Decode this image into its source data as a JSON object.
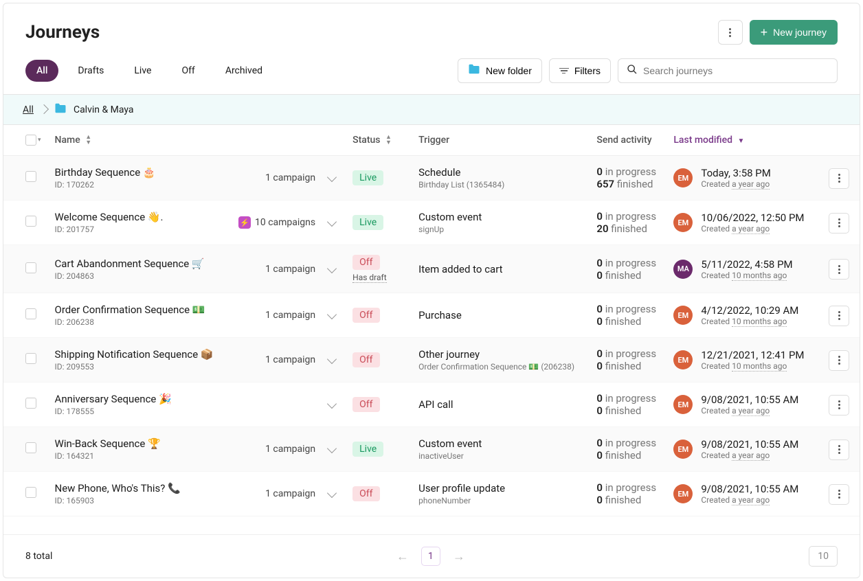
{
  "page_title": "Journeys",
  "header": {
    "new_journey_label": "New journey"
  },
  "tabs": {
    "all": "All",
    "drafts": "Drafts",
    "live": "Live",
    "off": "Off",
    "archived": "Archived"
  },
  "controls": {
    "new_folder": "New folder",
    "filters": "Filters",
    "search_placeholder": "Search journeys"
  },
  "breadcrumb": {
    "root": "All",
    "current": "Calvin & Maya"
  },
  "columns": {
    "name": "Name",
    "status": "Status",
    "trigger": "Trigger",
    "send_activity": "Send activity",
    "last_modified": "Last modified"
  },
  "rows": [
    {
      "name": "Birthday Sequence 🎂",
      "id_label": "ID: 170262",
      "campaigns": "1 campaign",
      "status": "Live",
      "trigger": "Schedule",
      "trigger_sub": "Birthday List (1365484)",
      "send_ip_n": "0",
      "send_ip_t": " in progress",
      "send_fin_n": "657",
      "send_fin_t": " finished",
      "avatar": "EM",
      "avatar_class": "av-em",
      "mod_date": "Today, 3:58 PM",
      "created_prefix": "Created ",
      "created_ago": "a year ago"
    },
    {
      "name": "Welcome Sequence 👋.",
      "id_label": "ID: 201757",
      "campaigns": "10 campaigns",
      "bolt": true,
      "status": "Live",
      "trigger": "Custom event",
      "trigger_sub": "signUp",
      "send_ip_n": "0",
      "send_ip_t": " in progress",
      "send_fin_n": "20",
      "send_fin_t": " finished",
      "avatar": "EM",
      "avatar_class": "av-em",
      "mod_date": "10/06/2022, 12:50 PM",
      "created_prefix": "Created ",
      "created_ago": "a year ago"
    },
    {
      "name": "Cart Abandonment Sequence 🛒",
      "id_label": "ID: 204863",
      "campaigns": "1 campaign",
      "status": "Off",
      "has_draft_label": "Has draft",
      "trigger": "Item added to cart",
      "send_ip_n": "0",
      "send_ip_t": " in progress",
      "send_fin_n": "0",
      "send_fin_t": " finished",
      "avatar": "MA",
      "avatar_class": "av-ma",
      "mod_date": "5/11/2022, 4:58 PM",
      "created_prefix": "Created ",
      "created_ago": "10 months ago"
    },
    {
      "name": "Order Confirmation Sequence 💵",
      "id_label": "ID: 206238",
      "campaigns": "1 campaign",
      "status": "Off",
      "trigger": "Purchase",
      "send_ip_n": "0",
      "send_ip_t": " in progress",
      "send_fin_n": "0",
      "send_fin_t": " finished",
      "avatar": "EM",
      "avatar_class": "av-em",
      "mod_date": "4/12/2022, 10:29 AM",
      "created_prefix": "Created ",
      "created_ago": "10 months ago"
    },
    {
      "name": "Shipping Notification Sequence 📦",
      "id_label": "ID: 209553",
      "campaigns": "1 campaign",
      "status": "Off",
      "trigger": "Other journey",
      "trigger_sub": "Order Confirmation Sequence 💵 (206238)",
      "send_ip_n": "0",
      "send_ip_t": " in progress",
      "send_fin_n": "0",
      "send_fin_t": " finished",
      "avatar": "EM",
      "avatar_class": "av-em",
      "mod_date": "12/21/2021, 12:41 PM",
      "created_prefix": "Created ",
      "created_ago": "10 months ago"
    },
    {
      "name": "Anniversary Sequence 🎉",
      "id_label": "ID: 178555",
      "campaigns": "",
      "status": "Off",
      "trigger": "API call",
      "send_ip_n": "0",
      "send_ip_t": " in progress",
      "send_fin_n": "0",
      "send_fin_t": " finished",
      "avatar": "EM",
      "avatar_class": "av-em",
      "mod_date": "9/08/2021, 10:55 AM",
      "created_prefix": "Created ",
      "created_ago": "a year ago"
    },
    {
      "name": "Win-Back Sequence 🏆",
      "id_label": "ID: 164321",
      "campaigns": "1 campaign",
      "status": "Live",
      "trigger": "Custom event",
      "trigger_sub": "inactiveUser",
      "send_ip_n": "0",
      "send_ip_t": " in progress",
      "send_fin_n": "0",
      "send_fin_t": " finished",
      "avatar": "EM",
      "avatar_class": "av-em",
      "mod_date": "9/08/2021, 10:55 AM",
      "created_prefix": "Created ",
      "created_ago": "a year ago"
    },
    {
      "name": "New Phone, Who's This? 📞",
      "id_label": "ID: 165903",
      "campaigns": "1 campaign",
      "status": "Off",
      "trigger": "User profile update",
      "trigger_sub": "phoneNumber",
      "send_ip_n": "0",
      "send_ip_t": " in progress",
      "send_fin_n": "0",
      "send_fin_t": " finished",
      "avatar": "EM",
      "avatar_class": "av-em",
      "mod_date": "9/08/2021, 10:55 AM",
      "created_prefix": "Created ",
      "created_ago": "a year ago"
    }
  ],
  "footer": {
    "total": "8 total",
    "page": "1",
    "page_size": "10"
  }
}
